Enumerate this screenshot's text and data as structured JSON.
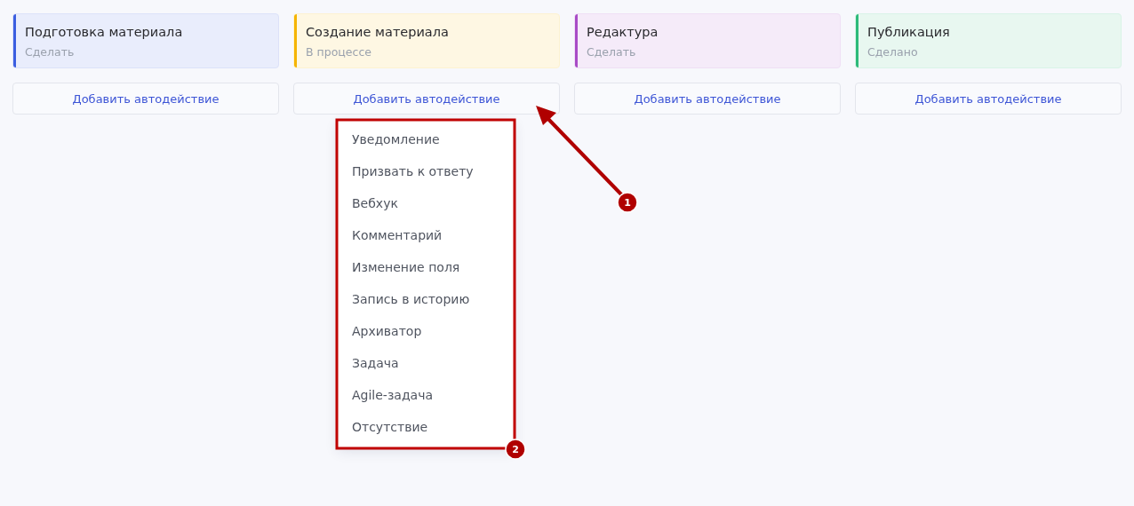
{
  "columns": [
    {
      "title": "Подготовка материала",
      "status": "Сделать",
      "color": "#3b5ee0",
      "button": "Добавить автодействие"
    },
    {
      "title": "Создание материала",
      "status": "В процессе",
      "color": "#f5b400",
      "button": "Добавить автодействие"
    },
    {
      "title": "Редактура",
      "status": "Сделать",
      "color": "#a84cc6",
      "button": "Добавить автодействие"
    },
    {
      "title": "Публикация",
      "status": "Сделано",
      "color": "#2dba7a",
      "button": "Добавить автодействие"
    }
  ],
  "dropdown": {
    "items": [
      "Уведомление",
      "Призвать к ответу",
      "Вебхук",
      "Комментарий",
      "Изменение поля",
      "Запись в историю",
      "Архиватор",
      "Задача",
      "Agile-задача",
      "Отсутствие"
    ]
  },
  "annotations": [
    {
      "kind": "arrow",
      "label": "1"
    },
    {
      "kind": "frame",
      "label": "2"
    }
  ]
}
